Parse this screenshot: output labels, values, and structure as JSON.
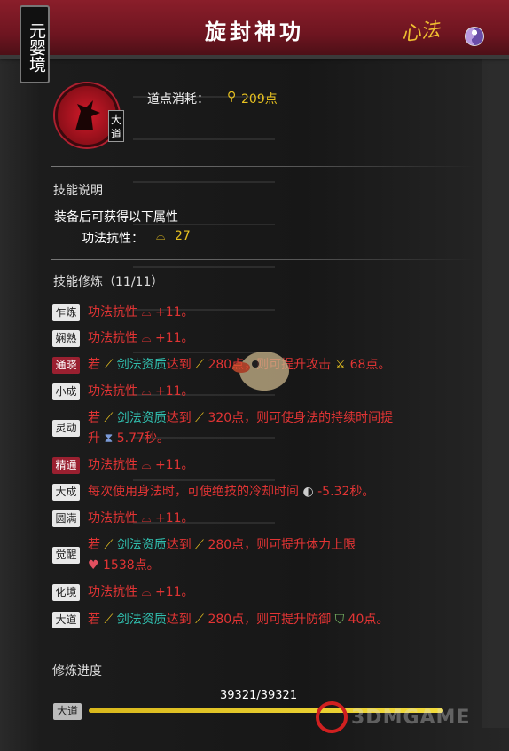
{
  "header": {
    "title": "旋封神功",
    "realm": "元婴境",
    "category": "心法"
  },
  "skill": {
    "tier_tag": "大道",
    "cost_label": "道点消耗：",
    "cost_value": "209点"
  },
  "description": {
    "heading": "技能说明",
    "intro": "装备后可获得以下属性",
    "attribute_name": "功法抗性：",
    "attribute_value": "27"
  },
  "training": {
    "heading": "技能修炼（11/11）",
    "stages": [
      {
        "tag": "乍炼",
        "text": "功法抗性 ⌓ +11。"
      },
      {
        "tag": "娴熟",
        "text": "功法抗性 ⌓ +11。"
      },
      {
        "tag": "通晓",
        "pre": "若 ",
        "hl": "剑法资质",
        "post": "达到 ",
        "rest": "280点，则可提升攻击 ",
        "value": "68点。"
      },
      {
        "tag": "小成",
        "text": "功法抗性 ⌓ +11。"
      },
      {
        "tag": "灵动",
        "pre": "若 ",
        "hl": "剑法资质",
        "post": "达到 ",
        "rest": "320点，则可使身法的持续时间提",
        "line2": "升 ",
        "value": "5.77秒。"
      },
      {
        "tag": "精通",
        "text": "功法抗性 ⌓ +11。"
      },
      {
        "tag": "大成",
        "text": "每次使用身法时，可使绝技的冷却时间 ",
        "value": "-5.32秒。"
      },
      {
        "tag": "圆满",
        "text": "功法抗性 ⌓ +11。"
      },
      {
        "tag": "觉醒",
        "pre": "若 ",
        "hl": "剑法资质",
        "post": "达到 ",
        "rest": "280点，则可提升体力上限",
        "value": "1538点。"
      },
      {
        "tag": "化境",
        "text": "功法抗性 ⌓ +11。"
      },
      {
        "tag": "大道",
        "pre": "若 ",
        "hl": "剑法资质",
        "post": "达到 ",
        "rest": "280点，则可提升防御 ",
        "value": "40点。"
      }
    ]
  },
  "progress": {
    "heading": "修炼进度",
    "text": "39321/39321",
    "stage": "大道",
    "fraction": 1.0
  },
  "watermark": "3DMGAME",
  "colors": {
    "header": "#7a1823",
    "accent_gold": "#e6c020",
    "effect_red": "#e23434",
    "highlight_teal": "#31c0b0"
  }
}
